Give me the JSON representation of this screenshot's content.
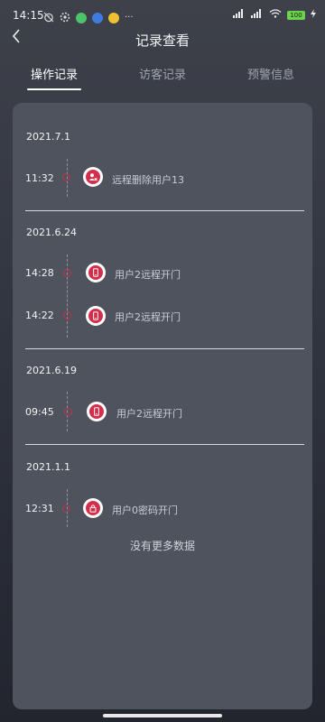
{
  "status_bar": {
    "time": "14:15",
    "more": "···",
    "battery": "100"
  },
  "header": {
    "title": "记录查看"
  },
  "tabs": [
    {
      "label": "操作记录",
      "active": true
    },
    {
      "label": "访客记录",
      "active": false
    },
    {
      "label": "预警信息",
      "active": false
    }
  ],
  "groups": [
    {
      "date": "2021.7.1",
      "records": [
        {
          "time": "11:32",
          "text": "远程删除用户13",
          "icon": "delete-user-icon"
        }
      ]
    },
    {
      "date": "2021.6.24",
      "records": [
        {
          "time": "14:28",
          "text": "用户2远程开门",
          "icon": "phone-icon"
        },
        {
          "time": "14:22",
          "text": "用户2远程开门",
          "icon": "phone-icon"
        }
      ]
    },
    {
      "date": "2021.6.19",
      "records": [
        {
          "time": "09:45",
          "text": "用户2远程开门",
          "icon": "phone-icon"
        }
      ]
    },
    {
      "date": "2021.1.1",
      "records": [
        {
          "time": "12:31",
          "text": "用户0密码开门",
          "icon": "lock-icon"
        }
      ]
    }
  ],
  "footer_text": "没有更多数据",
  "colors": {
    "accent": "#d32f4a",
    "card": "#4f535d",
    "background": "#343842"
  }
}
